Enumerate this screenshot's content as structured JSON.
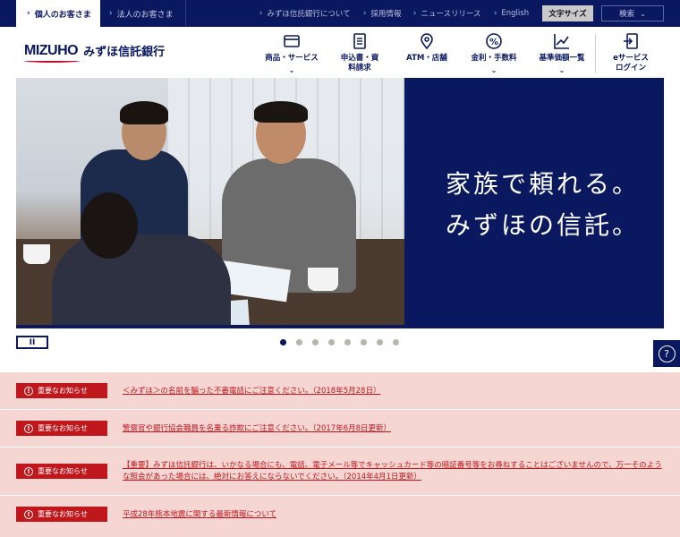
{
  "topbar": {
    "tabs": [
      {
        "label": "個人のお客さま",
        "active": true
      },
      {
        "label": "法人のお客さま",
        "active": false
      }
    ],
    "links": [
      "みずほ信託銀行について",
      "採用情報",
      "ニュースリリース",
      "English"
    ],
    "font_size_label": "文字サイズ",
    "search_label": "検索"
  },
  "header": {
    "logo_en": "MIZUHO",
    "logo_ja": "みずほ信託銀行",
    "nav": [
      {
        "label": "商品・サービス",
        "icon": "card-icon",
        "has_dropdown": true
      },
      {
        "label": "申込書・資料請求",
        "icon": "document-icon",
        "has_dropdown": false
      },
      {
        "label": "ATM・店舗",
        "icon": "map-pin-icon",
        "has_dropdown": false
      },
      {
        "label": "金利・手数料",
        "icon": "percent-icon",
        "has_dropdown": true
      },
      {
        "label": "基準価額一覧",
        "icon": "chart-icon",
        "has_dropdown": true
      },
      {
        "label": "eサービスログイン",
        "icon": "login-icon",
        "has_dropdown": false
      }
    ]
  },
  "hero": {
    "copy_line1": "家族で頼れる。",
    "copy_line2": "みずほの信託。",
    "slide_count": 8,
    "active_slide": 1
  },
  "controls": {
    "pause_label": "II",
    "help_label": "?"
  },
  "notices": [
    {
      "badge": "重要なお知らせ",
      "text": "＜みずほ＞の名前を騙った不審電話にご注意ください。（2018年5月28日）"
    },
    {
      "badge": "重要なお知らせ",
      "text": "警察官や銀行協会職員を名乗る詐欺にご注意ください。（2017年6月8日更新）"
    },
    {
      "badge": "重要なお知らせ",
      "text": "【重要】みずほ信託銀行は、いかなる場合にも、電話、電子メール等でキャッシュカード等の暗証番号等をお尋ねすることはございませんので、万一そのような照会があった場合には、絶対にお答えにならないでください。（2014年4月1日更新）"
    },
    {
      "badge": "重要なお知らせ",
      "text": "平成28年熊本地震に関する最新情報について"
    }
  ],
  "colors": {
    "brand_navy": "#0a1860",
    "notice_red": "#c0171d",
    "notice_bg": "#f5d6d2"
  }
}
